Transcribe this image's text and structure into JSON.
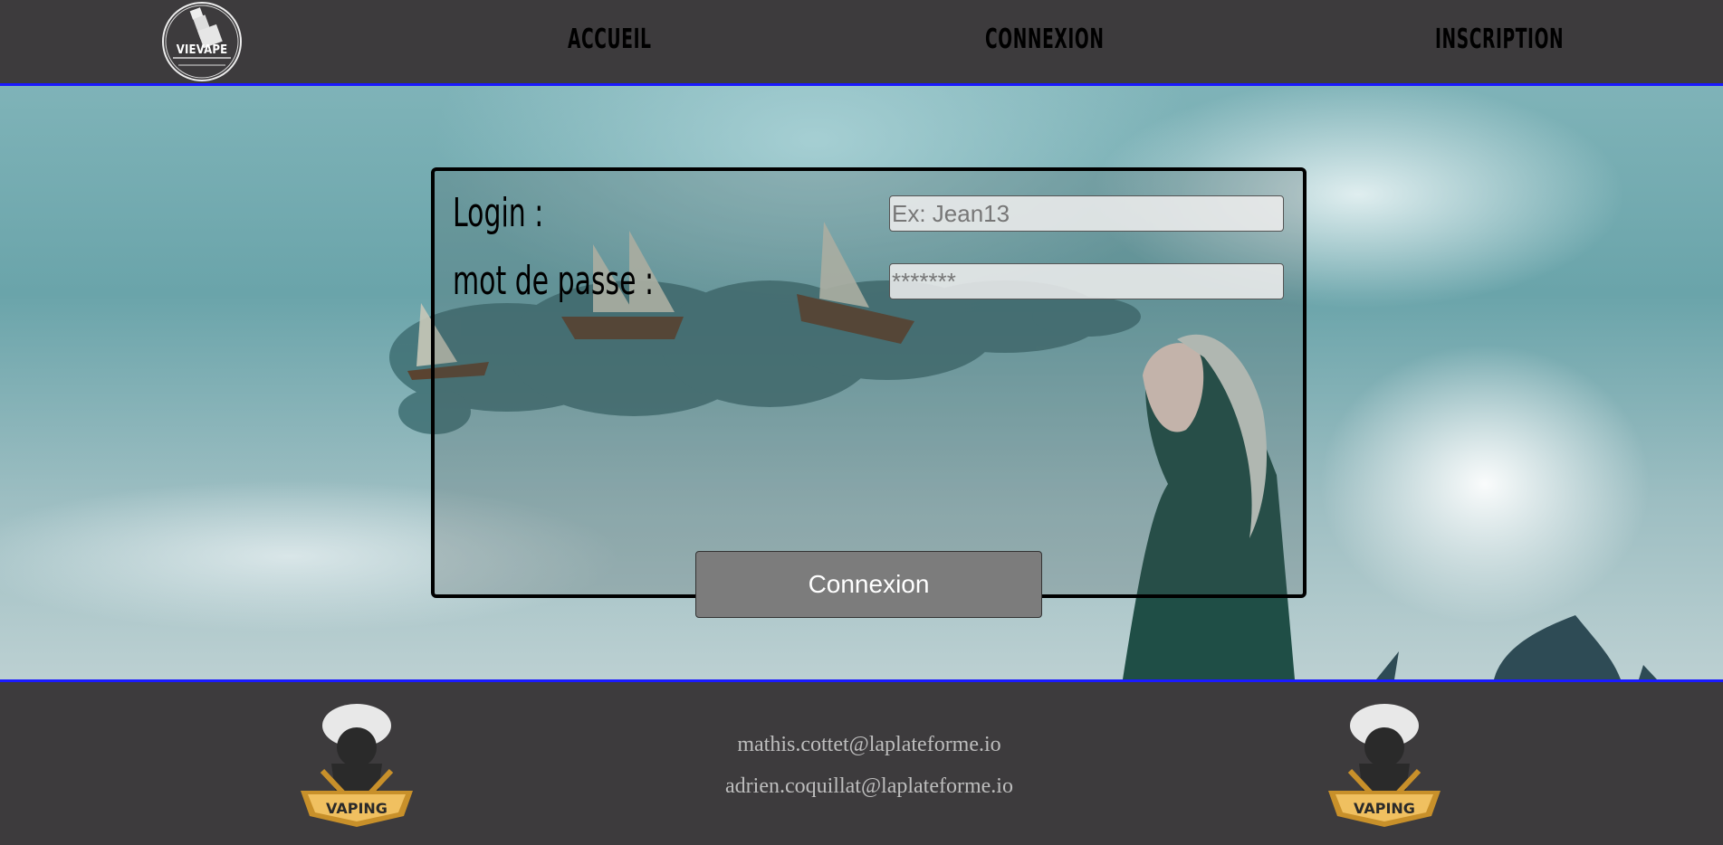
{
  "header": {
    "logo_text": "VIEVAPE",
    "nav": [
      {
        "label": "ACCUEIL"
      },
      {
        "label": "CONNEXION"
      },
      {
        "label": "INSCRIPTION"
      }
    ]
  },
  "login_form": {
    "login_label": "Login :",
    "password_label": "mot de passe :",
    "login_placeholder": "Ex: Jean13",
    "password_placeholder": "*******",
    "submit_label": "Connexion"
  },
  "footer": {
    "emails": [
      "mathis.cottet@laplateforme.io",
      "adrien.coquillat@laplateforme.io"
    ],
    "badge_text": "VAPING"
  },
  "colors": {
    "background": "#3d3b3d",
    "accent_border": "#1a1aff",
    "button": "#7c7c7c",
    "footer_text": "#bdbdbd"
  }
}
